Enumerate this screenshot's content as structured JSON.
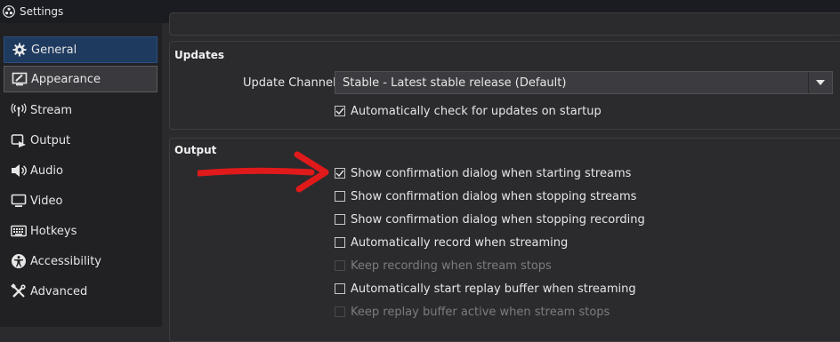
{
  "window": {
    "title": "Settings"
  },
  "sidebar": {
    "items": [
      {
        "label": "General",
        "icon": "gear-icon",
        "state": "selected"
      },
      {
        "label": "Appearance",
        "icon": "appearance-icon",
        "state": "hover"
      },
      {
        "label": "Stream",
        "icon": "antenna-icon",
        "state": "normal"
      },
      {
        "label": "Output",
        "icon": "output-icon",
        "state": "normal"
      },
      {
        "label": "Audio",
        "icon": "speaker-icon",
        "state": "normal"
      },
      {
        "label": "Video",
        "icon": "monitor-icon",
        "state": "normal"
      },
      {
        "label": "Hotkeys",
        "icon": "keyboard-icon",
        "state": "normal"
      },
      {
        "label": "Accessibility",
        "icon": "accessibility-icon",
        "state": "normal"
      },
      {
        "label": "Advanced",
        "icon": "tools-icon",
        "state": "normal"
      }
    ]
  },
  "updates": {
    "title": "Updates",
    "channel_label": "Update Channel",
    "channel_value": "Stable - Latest stable release (Default)",
    "auto_check_label": "Automatically check for updates on startup",
    "auto_check": true
  },
  "output": {
    "title": "Output",
    "options": [
      {
        "label": "Show confirmation dialog when starting streams",
        "checked": true,
        "enabled": true
      },
      {
        "label": "Show confirmation dialog when stopping streams",
        "checked": false,
        "enabled": true
      },
      {
        "label": "Show confirmation dialog when stopping recording",
        "checked": false,
        "enabled": true
      },
      {
        "label": "Automatically record when streaming",
        "checked": false,
        "enabled": true
      },
      {
        "label": "Keep recording when stream stops",
        "checked": false,
        "enabled": false
      },
      {
        "label": "Automatically start replay buffer when streaming",
        "checked": false,
        "enabled": true
      },
      {
        "label": "Keep replay buffer active when stream stops",
        "checked": false,
        "enabled": false
      }
    ]
  },
  "colors": {
    "selected_bg": "#1f3a5f",
    "annotation_arrow": "#e01a1a",
    "titlebar_bg": "#1a1c22"
  }
}
